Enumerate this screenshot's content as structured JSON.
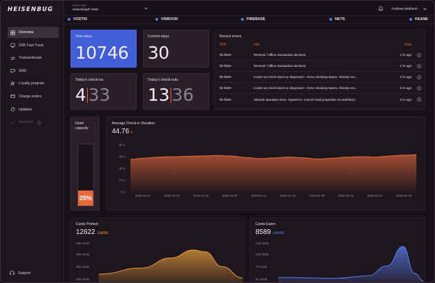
{
  "brand": {
    "logo": "HEISENBUG"
  },
  "sidebar": {
    "items": [
      {
        "label": "Overview",
        "icon": "dashboard-icon",
        "active": true
      },
      {
        "label": "SSK Fast Track",
        "icon": "kiosk-icon"
      },
      {
        "label": "Transactionals",
        "icon": "transaction-icon"
      },
      {
        "label": "SMS",
        "icon": "sms-icon"
      },
      {
        "label": "Loyalty program",
        "icon": "loyalty-icon"
      },
      {
        "label": "Charge orders",
        "icon": "credit-card-icon"
      },
      {
        "label": "Updates",
        "icon": "refresh-icon"
      },
      {
        "label": "Revenue",
        "icon": "revenue-icon",
        "disabled": true
      }
    ],
    "support_label": "Support"
  },
  "topbar": {
    "hotel_label": "Select hotel",
    "hotel_value": "Heisenbug® Hotel",
    "user_name": "Andreas Mathium"
  },
  "services": [
    "VOSTIO",
    "VISBOOK",
    "FIREBASE",
    "NETS",
    "KEANE"
  ],
  "accent": "#e86a3c",
  "blue": "#3f5ed8",
  "kpis": {
    "total_stays": {
      "title": "Total stays",
      "value": "10746"
    },
    "current_stays": {
      "title": "Current stays",
      "value": "30"
    },
    "checkins": {
      "title": "Today's check-ins",
      "done": "4",
      "total": "33"
    },
    "checkouts": {
      "title": "Today's check-outs",
      "done": "13",
      "total": "36"
    }
  },
  "errors": {
    "title": "Recent errors",
    "headers": [
      "SSK",
      "Info",
      "Time"
    ],
    "rows": [
      {
        "ssk": "hb-ft000",
        "info": "Terminal / offline transaction declined",
        "time": "1 hr ago"
      },
      {
        "ssk": "hb-ft000",
        "info": "Terminal / offline transaction declined",
        "time": "1 hr ago"
      },
      {
        "ssk": "hb-ft000",
        "info": "Could not check stock on dispenser! - Error checking status. Already rea...",
        "time": "2 hr ago"
      },
      {
        "ssk": "hb-ft000",
        "info": "Could not check stock on dispenser! - Error checking status. Already rea...",
        "time": "5 hr ago"
      },
      {
        "ssk": "hb-ft000",
        "info": "Visbook operation error: TypeError: Cannot read properties of undefined...",
        "time": "6 hr ago"
      }
    ]
  },
  "capacity": {
    "title": "Hotel capacity",
    "label": "25%",
    "fraction": 0.25
  },
  "avg_checkin": {
    "title": "Average Check-in Duration",
    "value": "44.76",
    "unit": "s"
  },
  "cards_printed": {
    "title": "Cards Printed",
    "value": "12622",
    "unit": "cards"
  },
  "cards_eaten": {
    "title": "Cards Eaten",
    "value": "8589",
    "unit": "cards"
  },
  "chart_data": [
    {
      "type": "area",
      "title": "Average Check-in Duration",
      "ylim": [
        0,
        60
      ],
      "yticks": [
        "0 s",
        "15 s",
        "30 s",
        "45 s",
        "60 s"
      ],
      "ytick_values": [
        0,
        15,
        30,
        45,
        60
      ],
      "xticks": [
        "2025-12-17",
        "2025-12-24",
        "2025-12-31",
        "2026-01-07",
        "2026-01-14",
        "2026-01-21",
        "2026-01-28",
        "2026-02-04",
        "2026-02-11",
        "2026-02-18"
      ],
      "x": [
        "2025-12-14",
        "2025-12-17",
        "2025-12-21",
        "2025-12-24",
        "2025-12-28",
        "2025-12-31",
        "2026-01-04",
        "2026-01-07",
        "2026-01-11",
        "2026-01-14",
        "2026-01-18",
        "2026-01-21",
        "2026-01-25",
        "2026-01-28",
        "2026-02-01",
        "2026-02-04",
        "2026-02-08",
        "2026-02-11",
        "2026-02-15",
        "2026-02-18",
        "2026-02-21"
      ],
      "values": [
        41.5,
        43,
        44.5,
        45,
        45.5,
        46,
        46.5,
        46,
        44,
        42.5,
        43.5,
        44.5,
        43.5,
        42,
        43,
        44.5,
        45,
        44.5,
        46,
        47,
        47.5
      ],
      "grid": false
    },
    {
      "type": "area",
      "title": "Cards Printed",
      "ylim": [
        100,
        400
      ],
      "yticks": [
        "400 cards",
        "300 cards",
        "200 cards",
        "100 cards"
      ],
      "ytick_values": [
        400,
        300,
        200,
        100
      ],
      "points": [
        [
          0,
          160
        ],
        [
          0.3,
          210
        ],
        [
          0.5,
          290
        ],
        [
          0.66,
          355
        ],
        [
          0.74,
          340
        ],
        [
          0.86,
          220
        ],
        [
          1,
          130
        ]
      ],
      "grid": false
    },
    {
      "type": "area",
      "title": "Cards Eaten",
      "ylim": [
        50,
        140
      ],
      "yticks": [
        "140 cards",
        "100 cards",
        "75 cards",
        "50 cards"
      ],
      "ytick_values": [
        140,
        100,
        75,
        50
      ],
      "points": [
        [
          0,
          60
        ],
        [
          0.4,
          58
        ],
        [
          0.62,
          64
        ],
        [
          0.75,
          88
        ],
        [
          0.86,
          135
        ],
        [
          0.94,
          70
        ],
        [
          1,
          52
        ]
      ],
      "grid": false
    }
  ]
}
